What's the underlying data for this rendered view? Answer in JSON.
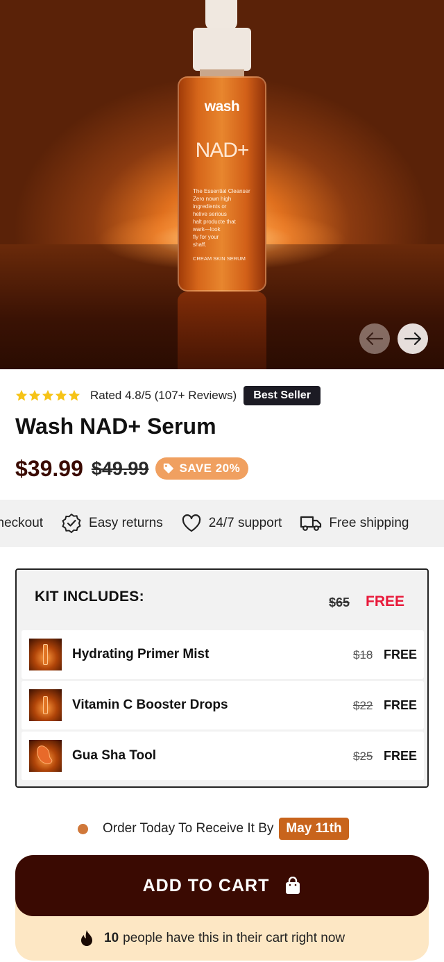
{
  "hero": {
    "bottle_brand": "wash",
    "bottle_name": "NAD+",
    "bottle_description": "The Essential Cleanser\nZero nown high\ningredients or\nhelive serious\nhalt producte that\nwark—look\nfly for your\nshaff.",
    "bottle_subtitle": "CREAM SKIN SERUM",
    "prev_icon": "arrow-left-icon",
    "next_icon": "arrow-right-icon"
  },
  "rating": {
    "stars": 5,
    "star_color": "#f6c316",
    "text": "Rated 4.8/5 (107+ Reviews)",
    "badge": "Best Seller"
  },
  "product": {
    "title": "Wash NAD+ Serum",
    "price": "$39.99",
    "old_price": "$49.99",
    "save_label": "SAVE 20%",
    "save_icon": "tag-icon"
  },
  "features": [
    {
      "label": "checkout",
      "icon": "lock-icon"
    },
    {
      "label": "Easy returns",
      "icon": "badge-check-icon"
    },
    {
      "label": "24/7 support",
      "icon": "heart-icon"
    },
    {
      "label": "Free shipping",
      "icon": "truck-icon"
    }
  ],
  "kit": {
    "heading": "KIT INCLUDES:",
    "old_total": "$65",
    "free_label": "FREE",
    "items": [
      {
        "name": "Hydrating Primer Mist",
        "old_price": "$18",
        "price": "FREE"
      },
      {
        "name": "Vitamin C Booster Drops",
        "old_price": "$22",
        "price": "FREE"
      },
      {
        "name": "Gua Sha Tool",
        "old_price": "$25",
        "price": "FREE"
      }
    ]
  },
  "delivery": {
    "text": "Order Today To Receive It By",
    "date": "May 11th"
  },
  "cart": {
    "button_label": "ADD TO CART",
    "button_icon": "shopping-bag-icon",
    "count": "10",
    "hype_text": "people have this in their cart right now",
    "hype_icon": "flame-icon"
  },
  "colors": {
    "accent": "#3a0a02",
    "save_badge": "#f0a060",
    "free_red": "#e8193a",
    "date_badge": "#c8641c",
    "cart_zone": "#fde7c4"
  }
}
